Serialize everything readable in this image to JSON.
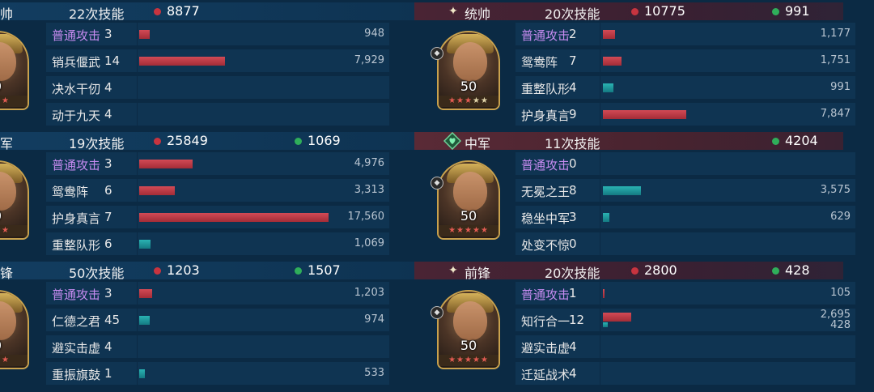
{
  "panels": [
    {
      "id": "left-top",
      "role": "帅",
      "skills": "22次技能",
      "red": "8877",
      "green": "",
      "level": "0",
      "stars": [
        "★",
        "★",
        "★"
      ],
      "star_colors": [
        "r",
        "r",
        "r"
      ],
      "rows": [
        {
          "name": "普通攻击",
          "count": "3",
          "value": "948",
          "red_frac": 0.054,
          "teal_frac": 0
        },
        {
          "name": "销兵偃武",
          "count": "14",
          "value": "7,929",
          "red_frac": 0.452,
          "teal_frac": 0
        },
        {
          "name": "决水干仞",
          "count": "4",
          "value": "",
          "red_frac": 0,
          "teal_frac": 0
        },
        {
          "name": "动于九天",
          "count": "4",
          "value": "",
          "red_frac": 0,
          "teal_frac": 0
        }
      ]
    },
    {
      "id": "left-mid",
      "role": "军",
      "skills": "19次技能",
      "red": "25849",
      "green": "1069",
      "level": "0",
      "stars": [
        "★",
        "★",
        "★"
      ],
      "star_colors": [
        "r",
        "",
        "r"
      ],
      "rows": [
        {
          "name": "普通攻击",
          "count": "3",
          "value": "4,976",
          "red_frac": 0.283,
          "teal_frac": 0
        },
        {
          "name": "鸳鸯阵",
          "count": "6",
          "value": "3,313",
          "red_frac": 0.189,
          "teal_frac": 0
        },
        {
          "name": "护身真言",
          "count": "7",
          "value": "17,560",
          "red_frac": 1.0,
          "teal_frac": 0
        },
        {
          "name": "重整队形",
          "count": "6",
          "value": "1,069",
          "red_frac": 0,
          "teal_frac": 0.061
        }
      ]
    },
    {
      "id": "left-bot",
      "role": "锋",
      "skills": "50次技能",
      "red": "1203",
      "green": "1507",
      "level": "0",
      "stars": [
        "★",
        "★",
        "★"
      ],
      "star_colors": [
        "r",
        "r",
        "r"
      ],
      "rows": [
        {
          "name": "普通攻击",
          "count": "3",
          "value": "1,203",
          "red_frac": 0.068,
          "teal_frac": 0
        },
        {
          "name": "仁德之君",
          "count": "45",
          "value": "974",
          "red_frac": 0,
          "teal_frac": 0.055
        },
        {
          "name": "避实击虚",
          "count": "4",
          "value": "",
          "red_frac": 0,
          "teal_frac": 0
        },
        {
          "name": "重振旗鼓",
          "count": "1",
          "value": "533",
          "red_frac": 0,
          "teal_frac": 0.03
        }
      ]
    },
    {
      "id": "right-top",
      "role": "统帅",
      "skills": "20次技能",
      "red": "10775",
      "green": "991",
      "level": "50",
      "stars": [
        "★",
        "★",
        "★",
        "★",
        "★"
      ],
      "star_colors": [
        "r",
        "r",
        "r",
        "",
        ""
      ],
      "rows": [
        {
          "name": "普通攻击",
          "count": "2",
          "value": "1,177",
          "red_frac": 0.067,
          "teal_frac": 0
        },
        {
          "name": "鸳鸯阵",
          "count": "7",
          "value": "1,751",
          "red_frac": 0.1,
          "teal_frac": 0
        },
        {
          "name": "重整队形",
          "count": "4",
          "value": "991",
          "red_frac": 0,
          "teal_frac": 0.056
        },
        {
          "name": "护身真言",
          "count": "9",
          "value": "7,847",
          "red_frac": 0.447,
          "teal_frac": 0
        }
      ]
    },
    {
      "id": "right-mid",
      "role": "中军",
      "skills": "11次技能",
      "red": "",
      "green": "4204",
      "level": "50",
      "stars": [
        "★",
        "★",
        "★",
        "★",
        "★"
      ],
      "star_colors": [
        "r",
        "r",
        "r",
        "r",
        "r"
      ],
      "rows": [
        {
          "name": "普通攻击",
          "count": "0",
          "value": "",
          "red_frac": 0,
          "teal_frac": 0
        },
        {
          "name": "无冕之王",
          "count": "8",
          "value": "3,575",
          "red_frac": 0,
          "teal_frac": 0.204
        },
        {
          "name": "稳坐中军",
          "count": "3",
          "value": "629",
          "red_frac": 0,
          "teal_frac": 0.036
        },
        {
          "name": "处变不惊",
          "count": "0",
          "value": "",
          "red_frac": 0,
          "teal_frac": 0
        }
      ]
    },
    {
      "id": "right-bot",
      "role": "前锋",
      "skills": "20次技能",
      "red": "2800",
      "green": "428",
      "level": "50",
      "stars": [
        "★",
        "★",
        "★",
        "★",
        "★"
      ],
      "star_colors": [
        "r",
        "r",
        "r",
        "r",
        "r"
      ],
      "rows": [
        {
          "name": "普通攻击",
          "count": "1",
          "value": "105",
          "red_frac": 0.006,
          "teal_frac": 0
        },
        {
          "name": "知行合一",
          "count": "12",
          "value": "2,695",
          "value2": "428",
          "red_frac": 0.154,
          "teal_frac": 0.024
        },
        {
          "name": "避实击虚",
          "count": "4",
          "value": "",
          "red_frac": 0,
          "teal_frac": 0
        },
        {
          "name": "迁延战术",
          "count": "4",
          "value": "",
          "red_frac": 0,
          "teal_frac": 0
        }
      ]
    }
  ],
  "colors": {
    "red": "#c7343f",
    "green": "#2fae5a",
    "purple": "#c68bf0"
  },
  "icons": {
    "role": "sparkle-icon",
    "heal": "heart-badge-icon"
  }
}
